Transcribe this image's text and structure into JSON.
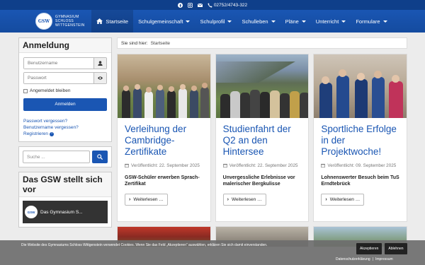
{
  "topbar": {
    "phone": "02752/4743-322"
  },
  "logo": {
    "badge": "GSW",
    "line1": "Gymnasium",
    "line2": "Schloss",
    "line3": "Wittgenstein"
  },
  "nav": {
    "items": [
      {
        "label": "Startseite"
      },
      {
        "label": "Schulgemeinschaft"
      },
      {
        "label": "Schulprofil"
      },
      {
        "label": "Schulleben"
      },
      {
        "label": "Pläne"
      },
      {
        "label": "Unterricht"
      },
      {
        "label": "Formulare"
      }
    ]
  },
  "login": {
    "title": "Anmeldung",
    "username_placeholder": "Benutzername",
    "password_placeholder": "Passwort",
    "remember": "Angemeldet bleiben",
    "button": "Anmelden",
    "forgot_password": "Passwort vergessen?",
    "forgot_username": "Benutzername vergessen?",
    "register": "Registrieren"
  },
  "search": {
    "placeholder": "Suche ..."
  },
  "gsw": {
    "title": "Das GSW stellt sich vor",
    "video_title": "Das Gymnasium S...",
    "video_logo": "GSW"
  },
  "breadcrumb": {
    "prefix": "Sie sind hier:",
    "current": "Startseite"
  },
  "articles": [
    {
      "title": "Verleihung der Cambridge-Zertifikate",
      "date": "Veröffentlicht: 22. September 2025",
      "lead": "GSW-Schüler erwerben Sprach-Zertifikat",
      "more": "Weiterlesen …"
    },
    {
      "title": "Studienfahrt der Q2 an den Hintersee",
      "date": "Veröffentlicht: 22. September 2025",
      "lead": "Unvergessliche Erlebnisse vor malerischer Bergkulisse",
      "more": "Weiterlesen …"
    },
    {
      "title": "Sportliche Erfolge in der Projektwoche!",
      "date": "Veröffentlicht: 09. September 2025",
      "lead": "Lohnenswerter Besuch beim TuS Erndtebrück",
      "more": "Weiterlesen …"
    }
  ],
  "cookie": {
    "message": "Die Website des Gymnasiums Schloss Wittgenstein verwendet Cookies. Wenn Sie das Feld „Akzeptieren“ auswählen, erklären Sie sich damit einverstanden.",
    "accept": "Akzeptieren",
    "reject": "Ablehnen",
    "privacy": "Datenschutzerklärung",
    "imprint": "Impressum"
  }
}
